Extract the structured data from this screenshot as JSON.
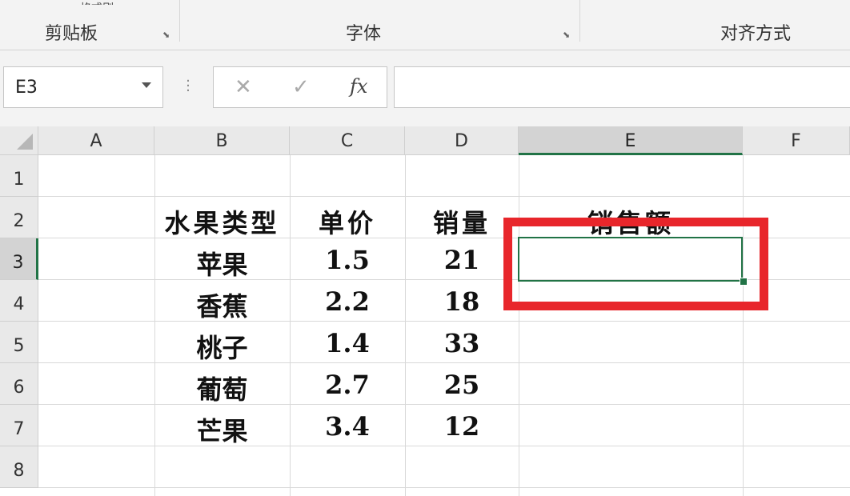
{
  "ribbon": {
    "clipboard_top": "格式刷",
    "groups": [
      {
        "label": "剪贴板"
      },
      {
        "label": "字体"
      },
      {
        "label": "对齐方式"
      }
    ]
  },
  "formula_bar": {
    "name_box": "E3",
    "cancel_glyph": "✕",
    "enter_glyph": "✓",
    "fx_glyph": "fx",
    "formula_value": ""
  },
  "sheet": {
    "columns": [
      "A",
      "B",
      "C",
      "D",
      "E",
      "F"
    ],
    "rows": [
      "1",
      "2",
      "3",
      "4",
      "5",
      "6",
      "7",
      "8"
    ],
    "active_cell": "E3",
    "header_row": {
      "b": "水果类型",
      "c": "单价",
      "d": "销量",
      "e": "销售额"
    },
    "data": [
      {
        "fruit": "苹果",
        "price": "1.5",
        "qty": "21"
      },
      {
        "fruit": "香蕉",
        "price": "2.2",
        "qty": "18"
      },
      {
        "fruit": "桃子",
        "price": "1.4",
        "qty": "33"
      },
      {
        "fruit": "葡萄",
        "price": "2.7",
        "qty": "25"
      },
      {
        "fruit": "芒果",
        "price": "3.4",
        "qty": "12"
      }
    ]
  },
  "colors": {
    "accent_green": "#217346",
    "highlight_red": "#e8262b"
  }
}
